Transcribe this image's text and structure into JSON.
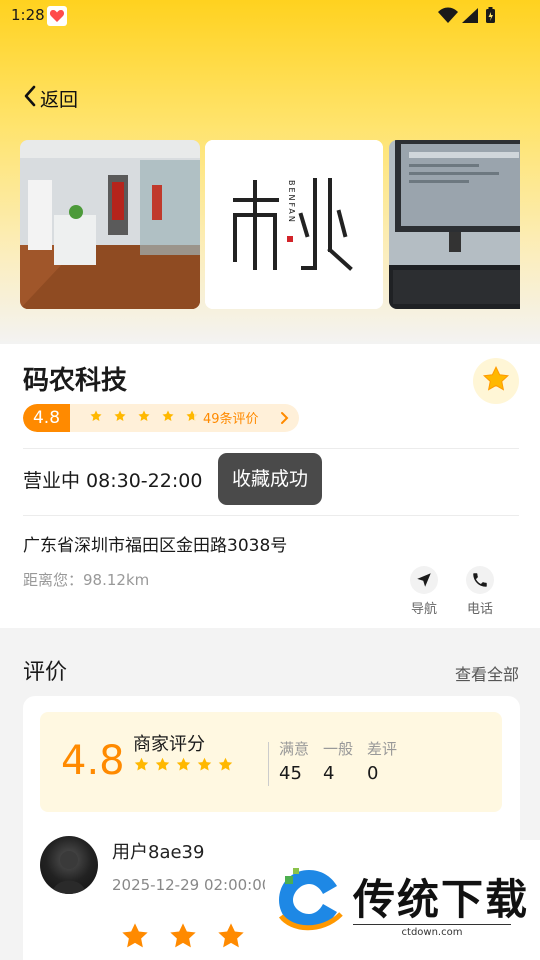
{
  "status": {
    "time": "1:28"
  },
  "header": {
    "back_label": "返回"
  },
  "shop": {
    "name": "码农科技",
    "score": "4.8",
    "review_count": "49条评价",
    "hours": "营业中 08:30-22:00",
    "address": "广东省深圳市福田区金田路3038号",
    "distance": "距离您：98.12km",
    "logo_text": "BENFAN"
  },
  "toast": {
    "text": "收藏成功"
  },
  "actions": {
    "nav_label": "导航",
    "call_label": "电话"
  },
  "reviews": {
    "title": "评价",
    "view_all": "查看全部",
    "merchant": {
      "score": "4.8",
      "label": "商家评分",
      "stats": [
        {
          "label": "满意",
          "value": "45"
        },
        {
          "label": "一般",
          "value": "4"
        },
        {
          "label": "差评",
          "value": "0"
        }
      ]
    },
    "first": {
      "user": "用户8ae39",
      "date": "2025-12-29 02:00:00"
    }
  },
  "watermark": {
    "brand": "传统下载",
    "url": "ctdown.com"
  },
  "colors": {
    "accent": "#ff8a00",
    "star": "#ffb800",
    "header_yellow": "#ffd21f"
  }
}
